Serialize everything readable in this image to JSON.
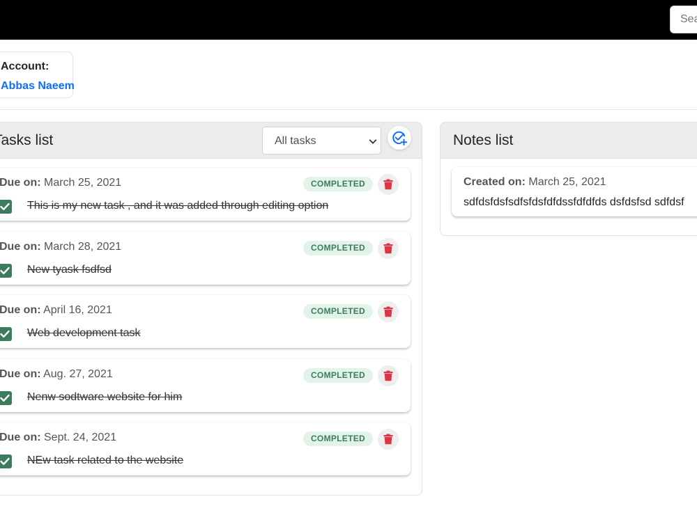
{
  "search": {
    "placeholder": "Search"
  },
  "account": {
    "label": "Account:",
    "name": "Abbas Naeem"
  },
  "tasks": {
    "title": "Tasks list",
    "filter_selected": "All tasks",
    "due_label": "Due on:",
    "items": [
      {
        "due": "March 25, 2021",
        "status": "COMPLETED",
        "text": "This is my new task , and it was added through editing option",
        "checked": true
      },
      {
        "due": "March 28, 2021",
        "status": "COMPLETED",
        "text": "New tyask fsdfsd",
        "checked": true
      },
      {
        "due": "April 16, 2021",
        "status": "COMPLETED",
        "text": "Web development task",
        "checked": true
      },
      {
        "due": "Aug. 27, 2021",
        "status": "COMPLETED",
        "text": "Nenw sodtware website for him",
        "checked": true
      },
      {
        "due": "Sept. 24, 2021",
        "status": "COMPLETED",
        "text": "NEw task related to the website",
        "checked": true
      }
    ]
  },
  "notes": {
    "title": "Notes list",
    "created_label": "Created on:",
    "items": [
      {
        "created": "March 25, 2021",
        "text": "sdfdsfdsfsdfsfdsfdfdssfdfdfds dsfdsfsd sdfdsf"
      }
    ]
  },
  "colors": {
    "accent": "#0d6efd",
    "completed": "#3d7a5e",
    "completed_bg": "#e2f3ea",
    "delete": "#dc3545"
  },
  "icons": {
    "add_task": "check-circle-plus-icon",
    "delete": "trash-icon",
    "checkbox": "checkmark-icon",
    "select": "chevron-down-icon"
  }
}
